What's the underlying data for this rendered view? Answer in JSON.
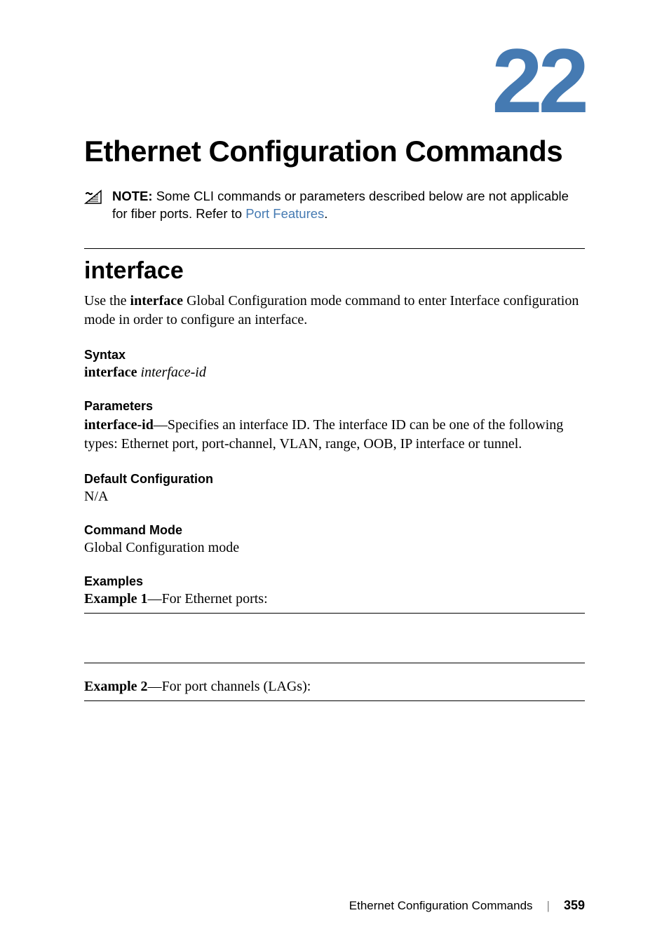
{
  "chapter": {
    "number": "22",
    "title": "Ethernet Configuration Commands"
  },
  "note": {
    "label": "NOTE:",
    "text_before_link": " Some CLI commands or parameters described below are not applicable for fiber ports. Refer to ",
    "link_text": "Port Features",
    "text_after_link": "."
  },
  "section": {
    "title": "interface",
    "intro_part1": "Use the ",
    "intro_bold": "interface",
    "intro_part2": " Global Configuration mode command to enter Interface configuration mode in order to configure an interface."
  },
  "syntax": {
    "heading": "Syntax",
    "command": "interface",
    "arg": "interface-id"
  },
  "parameters": {
    "heading": "Parameters",
    "name": "interface-id",
    "desc": "—Specifies an interface ID. The interface ID can be one of the following types: Ethernet port, port-channel, VLAN, range, OOB, IP interface or tunnel."
  },
  "default_config": {
    "heading": "Default Configuration",
    "value": "N/A"
  },
  "command_mode": {
    "heading": "Command Mode",
    "value": "Global Configuration mode"
  },
  "examples": {
    "heading": "Examples",
    "ex1_label": "Example 1",
    "ex1_desc": "—For Ethernet ports:",
    "ex2_label": "Example 2",
    "ex2_desc": "—For port channels (LAGs):"
  },
  "footer": {
    "chapter_name": "Ethernet Configuration Commands",
    "page": "359"
  }
}
